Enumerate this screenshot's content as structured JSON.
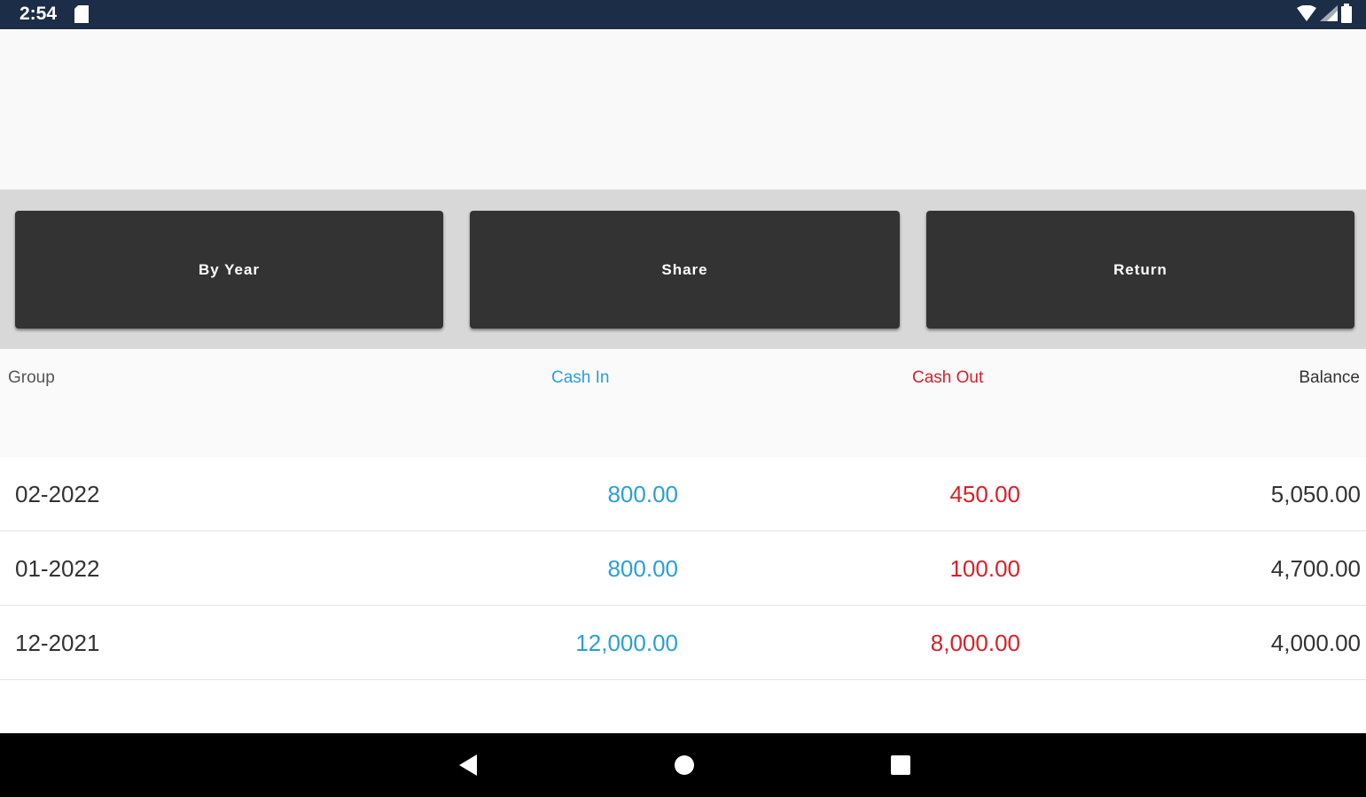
{
  "status_bar": {
    "time": "2:54",
    "sd_icon": "sd-card-icon",
    "wifi_icon": "wifi-icon",
    "signal_icon": "signal-icon",
    "battery_icon": "battery-icon"
  },
  "toolbar": {
    "buttons": [
      {
        "label": "By Year"
      },
      {
        "label": "Share"
      },
      {
        "label": "Return"
      }
    ]
  },
  "table": {
    "headers": {
      "group": "Group",
      "cash_in": "Cash In",
      "cash_out": "Cash Out",
      "balance": "Balance"
    },
    "rows": [
      {
        "group": "02-2022",
        "cash_in": "800.00",
        "cash_out": "450.00",
        "balance": "5,050.00"
      },
      {
        "group": "01-2022",
        "cash_in": "800.00",
        "cash_out": "100.00",
        "balance": "4,700.00"
      },
      {
        "group": "12-2021",
        "cash_in": "12,000.00",
        "cash_out": "8,000.00",
        "balance": "4,000.00"
      }
    ]
  },
  "colors": {
    "cash_in": "#2a9fd8",
    "cash_out": "#d8202a",
    "button_bg": "#333333",
    "status_bar": "#1c2d48"
  },
  "nav_bar": {
    "back_icon": "back-triangle-icon",
    "home_icon": "home-circle-icon",
    "recent_icon": "recent-apps-icon"
  }
}
